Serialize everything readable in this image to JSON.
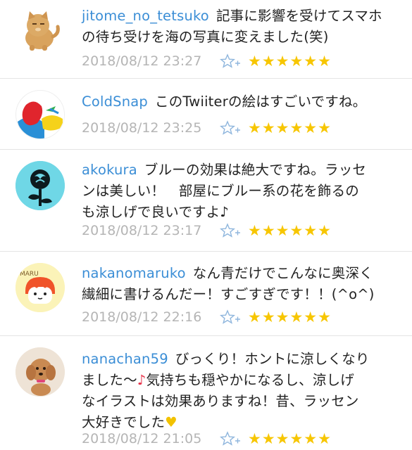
{
  "comments": [
    {
      "username": "jitome_no_tetsuko",
      "lines": [
        "記事に影響を受けてスマホ",
        "の待ち受けを海の写真に変えました(笑)"
      ],
      "timestamp": "2018/08/12 23:27",
      "stars": "★★★★★★",
      "rating": 6
    },
    {
      "username": "ColdSnap",
      "lines": [
        "このTwiiterの絵はすごいですね。"
      ],
      "timestamp": "2018/08/12 23:25",
      "stars": "★★★★★★",
      "rating": 6
    },
    {
      "username": "akokura",
      "lines": [
        "ブルーの効果は絶大ですね。ラッセ",
        "ンは美しい！　部屋にブルー系の花を飾るの",
        "も涼しげで良いですよ♪"
      ],
      "timestamp": "2018/08/12 23:17",
      "stars": "★★★★★★",
      "rating": 6
    },
    {
      "username": "nakanomaruko",
      "lines": [
        "なん青だけでこんなに奥深く",
        "繊細に書けるんだー！すごすぎです！！(^o^)"
      ],
      "timestamp": "2018/08/12 22:16",
      "stars": "★★★★★★",
      "rating": 6,
      "avatar_text": "MARU"
    },
    {
      "username": "nanachan59",
      "lines": [
        "びっくり！ホントに涼しくなり",
        "ました～",
        "気持ちも穏やかになるし、涼しげ",
        "なイラストは効果ありますね！昔、ラッセン",
        "大好きでした"
      ],
      "hearts": [
        "♪",
        "♥"
      ],
      "timestamp": "2018/08/12 21:05",
      "stars": "★★★★★★",
      "rating": 6
    }
  ],
  "colors": {
    "username": "#3b8ed6",
    "timestamp": "#b5b5b5",
    "star": "#f7c600",
    "divider": "#e4e4e4"
  },
  "icons": [
    "cat-avatar-icon",
    "coldsnap-avatar-icon",
    "rose-avatar-icon",
    "maru-avatar-icon",
    "dog-avatar-icon",
    "favorite-star-plus-icon",
    "rating-star-icon"
  ]
}
